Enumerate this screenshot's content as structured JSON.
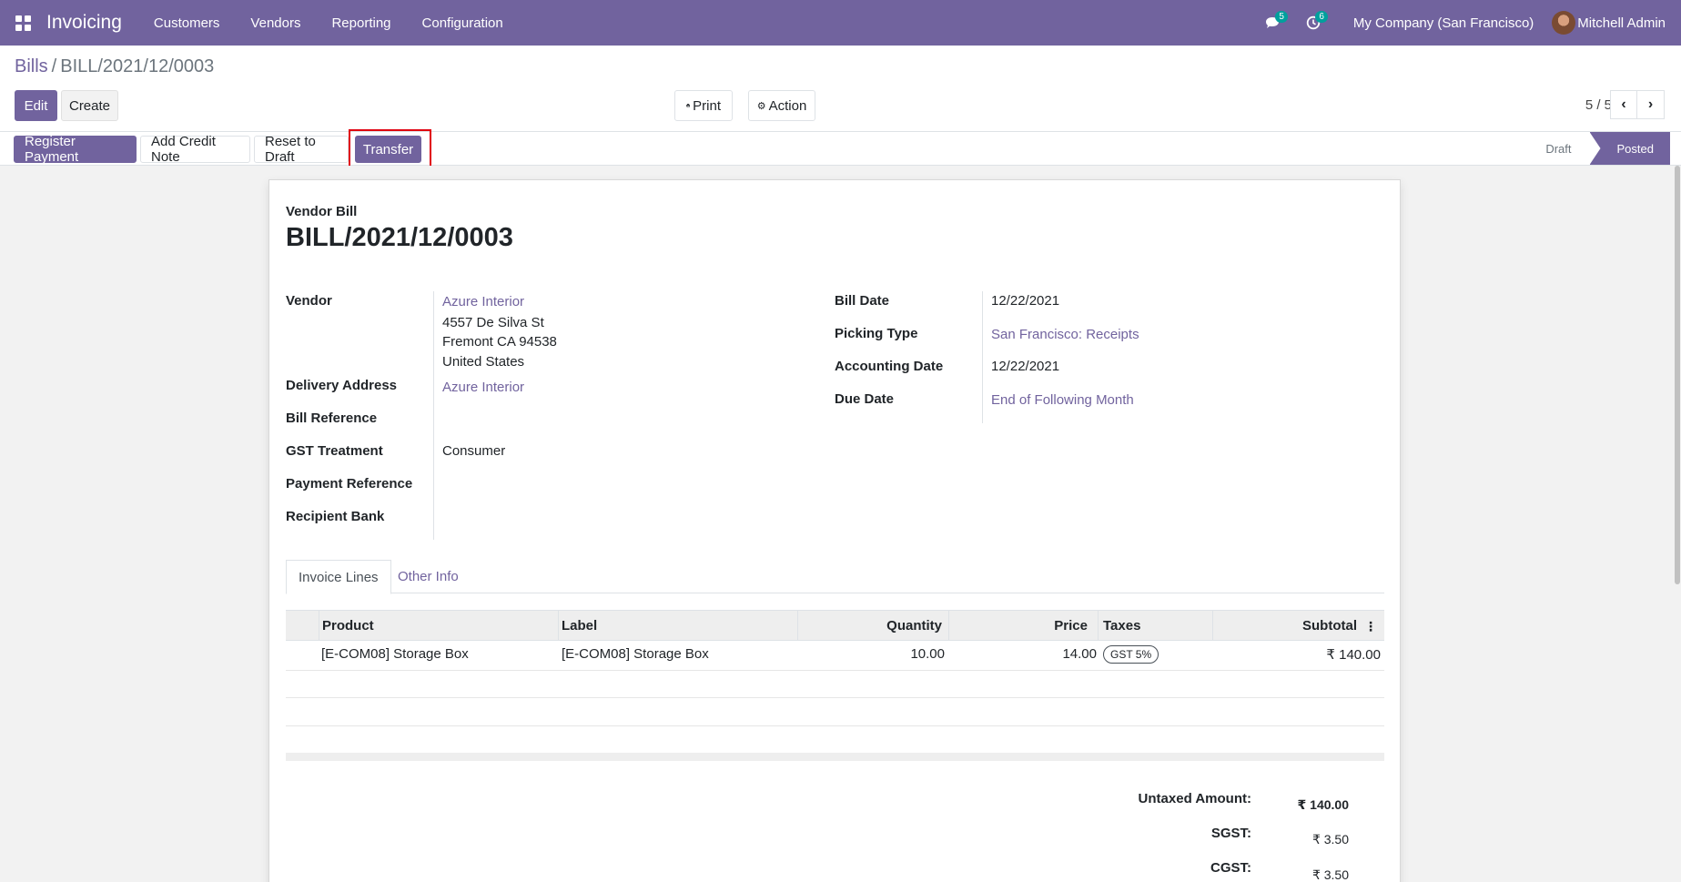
{
  "navbar": {
    "app_name": "Invoicing",
    "menu": [
      "Customers",
      "Vendors",
      "Reporting",
      "Configuration"
    ],
    "messages_count": "5",
    "activities_count": "6",
    "company": "My Company (San Francisco)",
    "user": "Mitchell Admin",
    "bg_color": "#71639e"
  },
  "breadcrumb": {
    "parent": "Bills",
    "separator": "/",
    "current": "BILL/2021/12/0003"
  },
  "control": {
    "edit": "Edit",
    "create": "Create",
    "print": "Print",
    "action": "Action",
    "pager": "5 / 5"
  },
  "statusbar": {
    "buttons": [
      "Register Payment",
      "Add Credit Note",
      "Reset to Draft",
      "Transfer"
    ],
    "states": [
      "Draft",
      "Posted"
    ],
    "current_state": "Posted"
  },
  "form": {
    "doc_type": "Vendor Bill",
    "name": "BILL/2021/12/0003",
    "left": {
      "vendor_label": "Vendor",
      "vendor": "Azure Interior",
      "address1": "4557 De Silva St",
      "address2": "Fremont CA 94538",
      "address3": "United States",
      "delivery_label": "Delivery Address",
      "delivery": "Azure Interior",
      "bill_ref_label": "Bill Reference",
      "gst_label": "GST Treatment",
      "gst": "Consumer",
      "payment_ref_label": "Payment Reference",
      "recipient_bank_label": "Recipient Bank"
    },
    "right": {
      "bill_date_label": "Bill Date",
      "bill_date": "12/22/2021",
      "picking_label": "Picking Type",
      "picking": "San Francisco: Receipts",
      "acc_date_label": "Accounting Date",
      "acc_date": "12/22/2021",
      "due_label": "Due Date",
      "due": "End of Following Month"
    }
  },
  "tabs": [
    "Invoice Lines",
    "Other Info"
  ],
  "table": {
    "columns": [
      "Product",
      "Label",
      "Quantity",
      "Price",
      "Taxes",
      "Subtotal"
    ],
    "rows": [
      {
        "product": "[E-COM08] Storage Box",
        "label": "[E-COM08] Storage Box",
        "quantity": "10.00",
        "price": "14.00",
        "tax": "GST 5%",
        "subtotal": "₹ 140.00"
      }
    ]
  },
  "totals": {
    "untaxed_label": "Untaxed Amount:",
    "untaxed": "₹ 140.00",
    "sgst_label": "SGST:",
    "sgst": "₹ 3.50",
    "cgst_label": "CGST:",
    "cgst": "₹ 3.50"
  }
}
